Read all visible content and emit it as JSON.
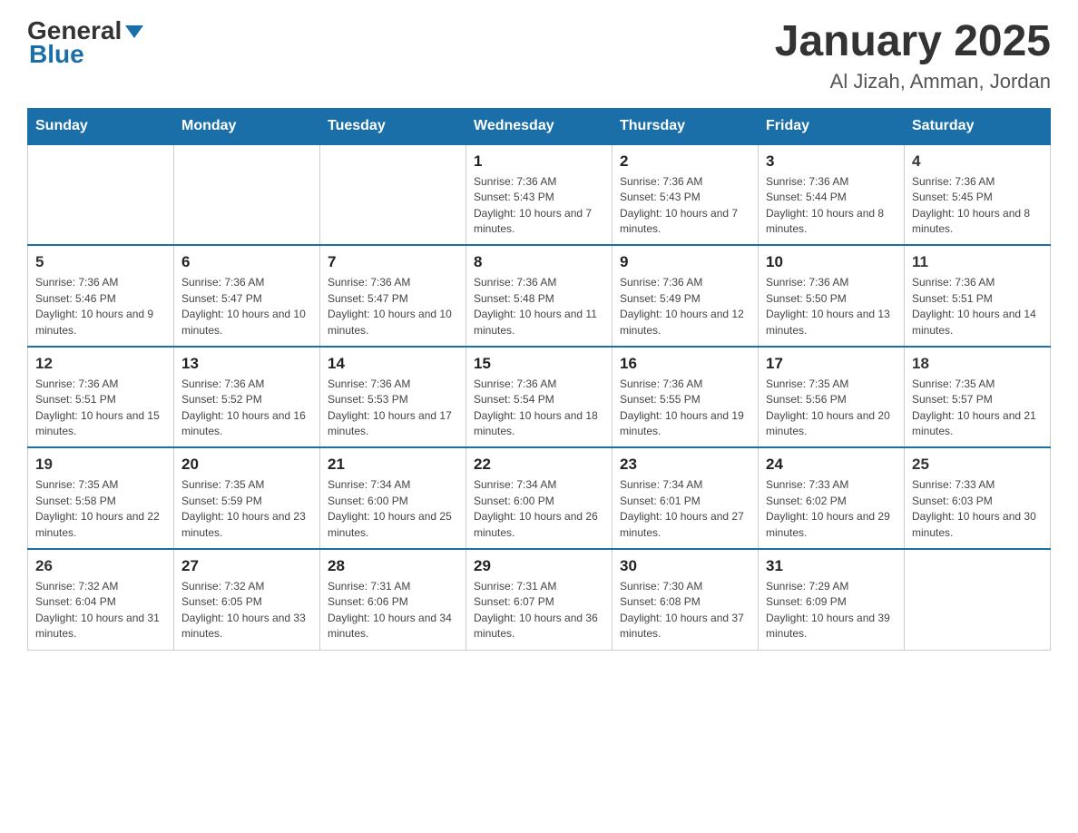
{
  "header": {
    "logo_general": "General",
    "logo_blue": "Blue",
    "title": "January 2025",
    "subtitle": "Al Jizah, Amman, Jordan"
  },
  "weekdays": [
    "Sunday",
    "Monday",
    "Tuesday",
    "Wednesday",
    "Thursday",
    "Friday",
    "Saturday"
  ],
  "weeks": [
    [
      {
        "day": "",
        "info": ""
      },
      {
        "day": "",
        "info": ""
      },
      {
        "day": "",
        "info": ""
      },
      {
        "day": "1",
        "info": "Sunrise: 7:36 AM\nSunset: 5:43 PM\nDaylight: 10 hours and 7 minutes."
      },
      {
        "day": "2",
        "info": "Sunrise: 7:36 AM\nSunset: 5:43 PM\nDaylight: 10 hours and 7 minutes."
      },
      {
        "day": "3",
        "info": "Sunrise: 7:36 AM\nSunset: 5:44 PM\nDaylight: 10 hours and 8 minutes."
      },
      {
        "day": "4",
        "info": "Sunrise: 7:36 AM\nSunset: 5:45 PM\nDaylight: 10 hours and 8 minutes."
      }
    ],
    [
      {
        "day": "5",
        "info": "Sunrise: 7:36 AM\nSunset: 5:46 PM\nDaylight: 10 hours and 9 minutes."
      },
      {
        "day": "6",
        "info": "Sunrise: 7:36 AM\nSunset: 5:47 PM\nDaylight: 10 hours and 10 minutes."
      },
      {
        "day": "7",
        "info": "Sunrise: 7:36 AM\nSunset: 5:47 PM\nDaylight: 10 hours and 10 minutes."
      },
      {
        "day": "8",
        "info": "Sunrise: 7:36 AM\nSunset: 5:48 PM\nDaylight: 10 hours and 11 minutes."
      },
      {
        "day": "9",
        "info": "Sunrise: 7:36 AM\nSunset: 5:49 PM\nDaylight: 10 hours and 12 minutes."
      },
      {
        "day": "10",
        "info": "Sunrise: 7:36 AM\nSunset: 5:50 PM\nDaylight: 10 hours and 13 minutes."
      },
      {
        "day": "11",
        "info": "Sunrise: 7:36 AM\nSunset: 5:51 PM\nDaylight: 10 hours and 14 minutes."
      }
    ],
    [
      {
        "day": "12",
        "info": "Sunrise: 7:36 AM\nSunset: 5:51 PM\nDaylight: 10 hours and 15 minutes."
      },
      {
        "day": "13",
        "info": "Sunrise: 7:36 AM\nSunset: 5:52 PM\nDaylight: 10 hours and 16 minutes."
      },
      {
        "day": "14",
        "info": "Sunrise: 7:36 AM\nSunset: 5:53 PM\nDaylight: 10 hours and 17 minutes."
      },
      {
        "day": "15",
        "info": "Sunrise: 7:36 AM\nSunset: 5:54 PM\nDaylight: 10 hours and 18 minutes."
      },
      {
        "day": "16",
        "info": "Sunrise: 7:36 AM\nSunset: 5:55 PM\nDaylight: 10 hours and 19 minutes."
      },
      {
        "day": "17",
        "info": "Sunrise: 7:35 AM\nSunset: 5:56 PM\nDaylight: 10 hours and 20 minutes."
      },
      {
        "day": "18",
        "info": "Sunrise: 7:35 AM\nSunset: 5:57 PM\nDaylight: 10 hours and 21 minutes."
      }
    ],
    [
      {
        "day": "19",
        "info": "Sunrise: 7:35 AM\nSunset: 5:58 PM\nDaylight: 10 hours and 22 minutes."
      },
      {
        "day": "20",
        "info": "Sunrise: 7:35 AM\nSunset: 5:59 PM\nDaylight: 10 hours and 23 minutes."
      },
      {
        "day": "21",
        "info": "Sunrise: 7:34 AM\nSunset: 6:00 PM\nDaylight: 10 hours and 25 minutes."
      },
      {
        "day": "22",
        "info": "Sunrise: 7:34 AM\nSunset: 6:00 PM\nDaylight: 10 hours and 26 minutes."
      },
      {
        "day": "23",
        "info": "Sunrise: 7:34 AM\nSunset: 6:01 PM\nDaylight: 10 hours and 27 minutes."
      },
      {
        "day": "24",
        "info": "Sunrise: 7:33 AM\nSunset: 6:02 PM\nDaylight: 10 hours and 29 minutes."
      },
      {
        "day": "25",
        "info": "Sunrise: 7:33 AM\nSunset: 6:03 PM\nDaylight: 10 hours and 30 minutes."
      }
    ],
    [
      {
        "day": "26",
        "info": "Sunrise: 7:32 AM\nSunset: 6:04 PM\nDaylight: 10 hours and 31 minutes."
      },
      {
        "day": "27",
        "info": "Sunrise: 7:32 AM\nSunset: 6:05 PM\nDaylight: 10 hours and 33 minutes."
      },
      {
        "day": "28",
        "info": "Sunrise: 7:31 AM\nSunset: 6:06 PM\nDaylight: 10 hours and 34 minutes."
      },
      {
        "day": "29",
        "info": "Sunrise: 7:31 AM\nSunset: 6:07 PM\nDaylight: 10 hours and 36 minutes."
      },
      {
        "day": "30",
        "info": "Sunrise: 7:30 AM\nSunset: 6:08 PM\nDaylight: 10 hours and 37 minutes."
      },
      {
        "day": "31",
        "info": "Sunrise: 7:29 AM\nSunset: 6:09 PM\nDaylight: 10 hours and 39 minutes."
      },
      {
        "day": "",
        "info": ""
      }
    ]
  ]
}
